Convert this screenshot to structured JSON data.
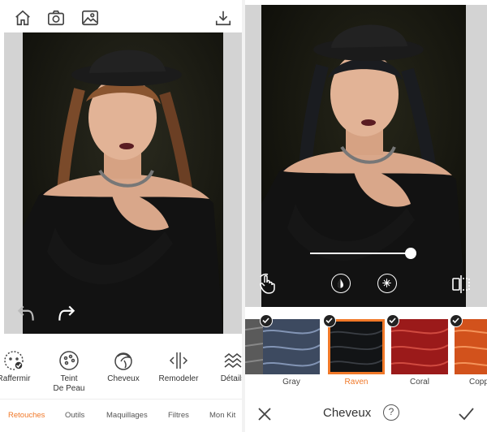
{
  "left_screen": {
    "tools": [
      {
        "label": "Raffermir",
        "icon": "smile-face-icon"
      },
      {
        "label": "Teint\nDe Peau",
        "icon": "palette-icon"
      },
      {
        "label": "Cheveux",
        "icon": "hair-icon"
      },
      {
        "label": "Remodeler",
        "icon": "reshape-icon"
      },
      {
        "label": "Détails",
        "icon": "wave-detail-icon"
      }
    ],
    "tabs": [
      {
        "label": "Retouches",
        "active": true
      },
      {
        "label": "Outils",
        "active": false
      },
      {
        "label": "Maquillages",
        "active": false
      },
      {
        "label": "Filtres",
        "active": false
      },
      {
        "label": "Mon Kit",
        "active": false
      }
    ]
  },
  "right_screen": {
    "hair_colors": [
      {
        "label": "Gray",
        "color": "#3d4a60",
        "selected": false,
        "checked": false
      },
      {
        "label": "Raven",
        "color": "#121416",
        "selected": true,
        "checked": true
      },
      {
        "label": "Coral",
        "color": "#9b1a1a",
        "selected": false,
        "checked": true
      },
      {
        "label": "Copper",
        "color": "#d2521c",
        "selected": false,
        "checked": true
      }
    ],
    "title": "Cheveux",
    "help": "?"
  },
  "colors": {
    "accent": "#f07828"
  }
}
